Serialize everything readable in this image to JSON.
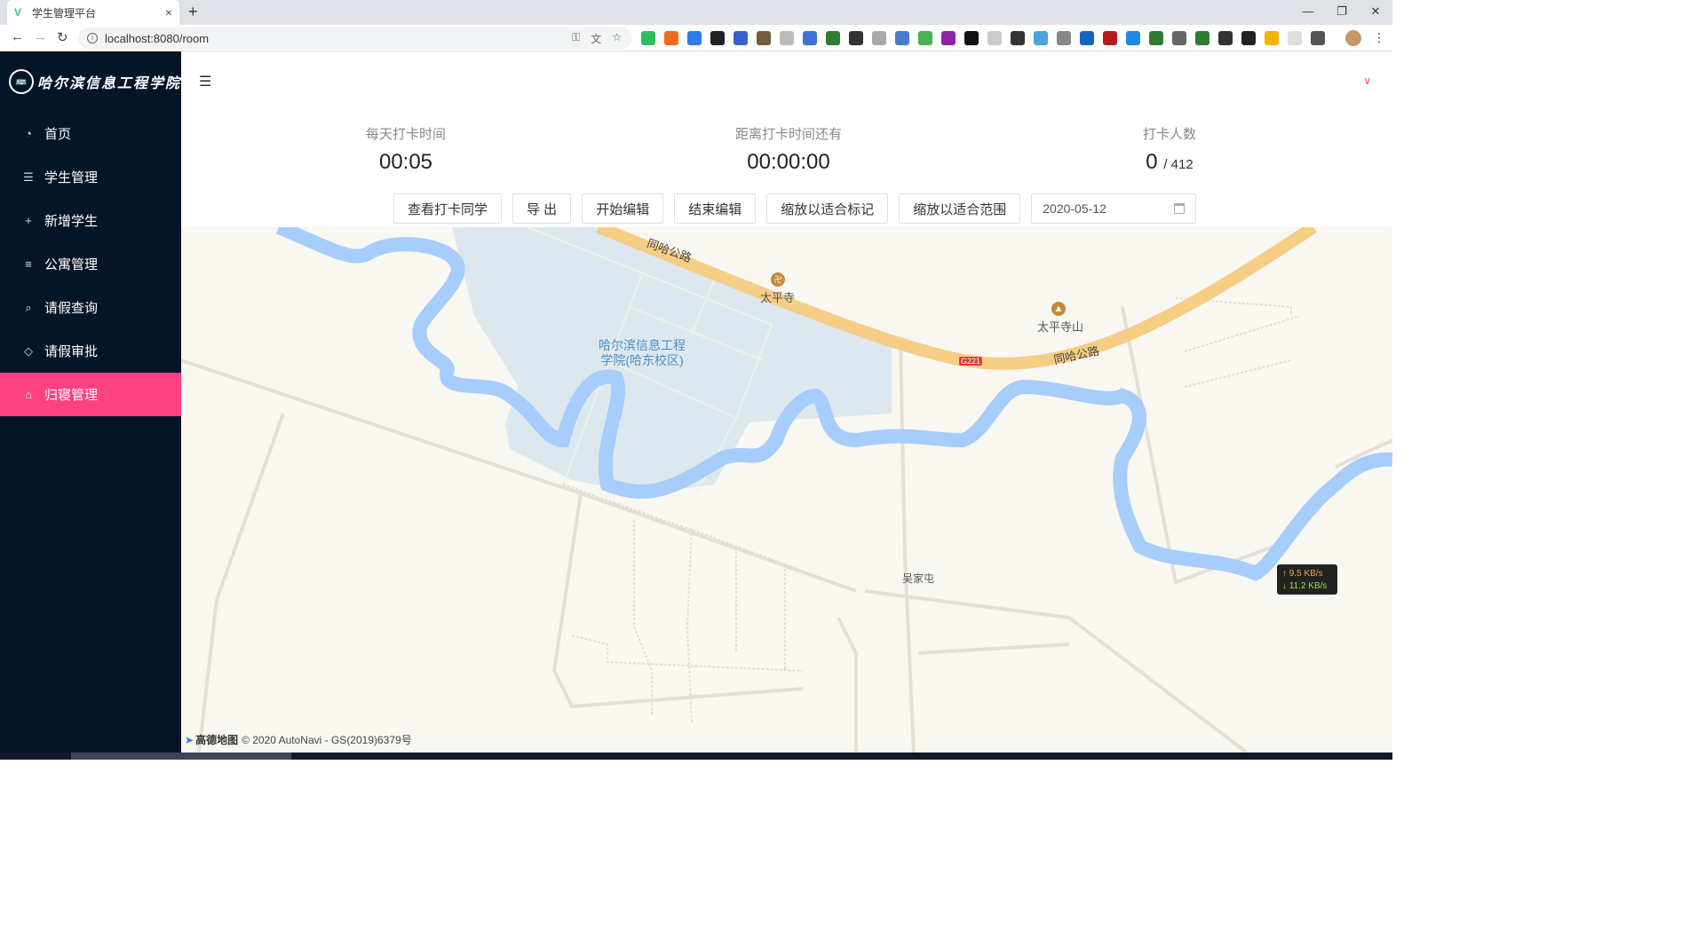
{
  "browser": {
    "tab_title": "学生管理平台",
    "tab_close": "×",
    "new_tab": "+",
    "url": "localhost:8080/room",
    "window_controls": [
      "—",
      "❐",
      "✕"
    ]
  },
  "sidebar": {
    "logo_text": "哈尔滨信息工程学院",
    "items": [
      {
        "label": "首页",
        "icon": "pie-chart-icon",
        "glyph": "◔"
      },
      {
        "label": "学生管理",
        "icon": "list-icon",
        "glyph": "☰"
      },
      {
        "label": "新增学生",
        "icon": "plus-icon",
        "glyph": "+"
      },
      {
        "label": "公寓管理",
        "icon": "align-left-icon",
        "glyph": "≡"
      },
      {
        "label": "请假查询",
        "icon": "search-icon",
        "glyph": "⌕"
      },
      {
        "label": "请假审批",
        "icon": "tag-icon",
        "glyph": "◇"
      },
      {
        "label": "归寝管理",
        "icon": "home-icon",
        "glyph": "⌂",
        "active": true
      }
    ],
    "active_color": "#ff4081",
    "bg_color": "#041527"
  },
  "stats": {
    "daily_time_label": "每天打卡时间",
    "daily_time_value": "00:05",
    "countdown_label": "距离打卡时间还有",
    "countdown_value": "00:00:00",
    "count_label": "打卡人数",
    "count_value": "0",
    "count_total": "/ 412"
  },
  "toolbar": {
    "view_button": "查看打卡同学",
    "export_button": "导 出",
    "start_edit_button": "开始编辑",
    "end_edit_button": "结束编辑",
    "fit_markers_button": "缩放以适合标记",
    "fit_range_button": "缩放以适合范围",
    "date_value": "2020-05-12"
  },
  "map": {
    "campus_label_line1": "哈尔滨信息工程",
    "campus_label_line2": "学院(哈东校区)",
    "poi_temple": "太平寺",
    "poi_mountain": "太平寺山",
    "road_name_1": "同哈公路",
    "road_name_2": "同哈公路",
    "highway_badge": "G221",
    "village": "吴家屯",
    "speed_up": "↑ 9.5 KB/s",
    "speed_down": "↓ 11.2 KB/s",
    "footer_brand": "高德地图",
    "footer_copyright": "© 2020 AutoNavi - GS(2019)6379号"
  }
}
